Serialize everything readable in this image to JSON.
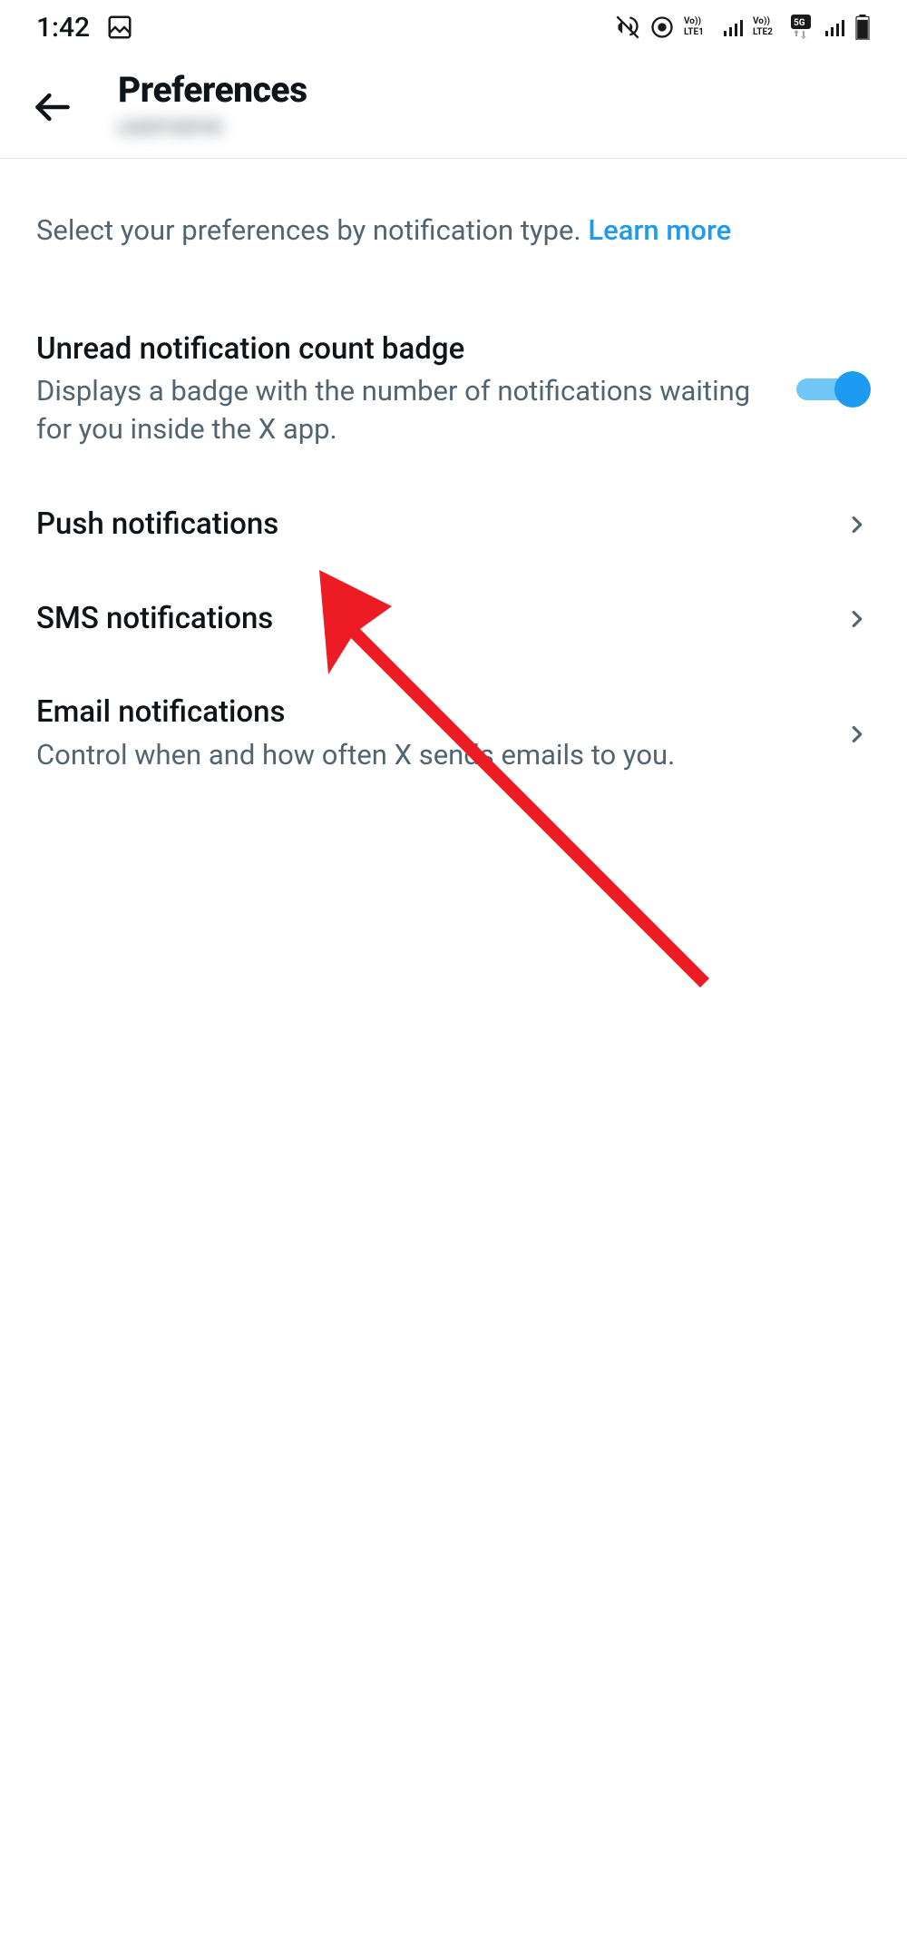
{
  "status_bar": {
    "time": "1:42"
  },
  "header": {
    "title": "Preferences",
    "subtitle": "username"
  },
  "intro": {
    "text": "Select your preferences by notification type. ",
    "link": "Learn more"
  },
  "settings": {
    "badge": {
      "title": "Unread notification count badge",
      "description": "Displays a badge with the number of notifications waiting for you inside the X app.",
      "enabled": true
    },
    "push": {
      "title": "Push notifications"
    },
    "sms": {
      "title": "SMS notifications"
    },
    "email": {
      "title": "Email notifications",
      "description": "Control when and how often X sends emails to you."
    }
  }
}
